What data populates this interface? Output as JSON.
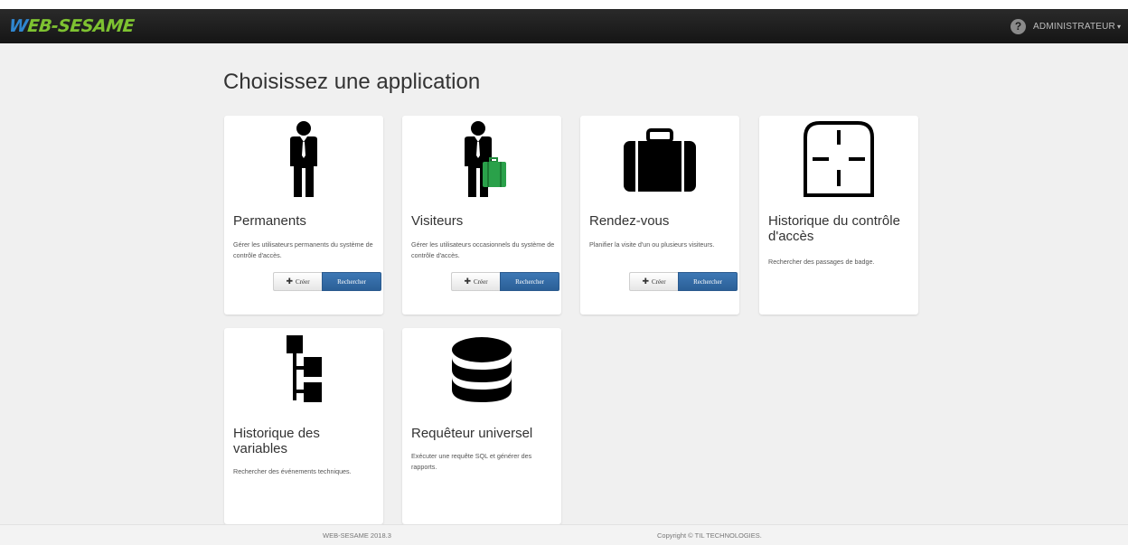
{
  "navbar": {
    "brand_prefix": "W",
    "brand_rest": "EB-SESAME",
    "user_icon_glyph": "?",
    "user_name": "ADMINISTRATEUR",
    "user_caret": "▾"
  },
  "page": {
    "title": "Choisissez une application"
  },
  "buttons": {
    "create_plus": "✚",
    "create": "Créer",
    "search": "Rechercher"
  },
  "cards": [
    {
      "id": "permanents",
      "title": "Permanents",
      "description": "Gérer les utilisateurs permanents du système de contrôle d'accès.",
      "icon": "person-icon"
    },
    {
      "id": "visiteurs",
      "title": "Visiteurs",
      "description": "Gérer les utilisateurs occasionnels du système de contrôle d'accès.",
      "icon": "visitor-icon"
    },
    {
      "id": "rendez-vous",
      "title": "Rendez-vous",
      "description": "Planifier la visite d'un ou plusieurs visiteurs.",
      "icon": "suitcase-icon"
    },
    {
      "id": "historique-acces",
      "title": "Historique du contrôle d'accès",
      "description": "Rechercher des passages de badge.",
      "icon": "door-access-icon"
    },
    {
      "id": "historique-variables",
      "title": "Historique des variables",
      "description": "Rechercher des événements techniques.",
      "icon": "tree-icon"
    },
    {
      "id": "requeteur",
      "title": "Requêteur universel",
      "description": "Exécuter une requête SQL et générer des rapports.",
      "icon": "database-icon"
    }
  ],
  "footer": {
    "version": "WEB-SESAME 2018.3",
    "copyright": "Copyright © TIL TECHNOLOGIES."
  },
  "colors": {
    "brand_green": "#7ec231",
    "brand_blue": "#2f86cf",
    "primary_button": "#2b5f97",
    "visitor_bag": "#2aa14a"
  }
}
